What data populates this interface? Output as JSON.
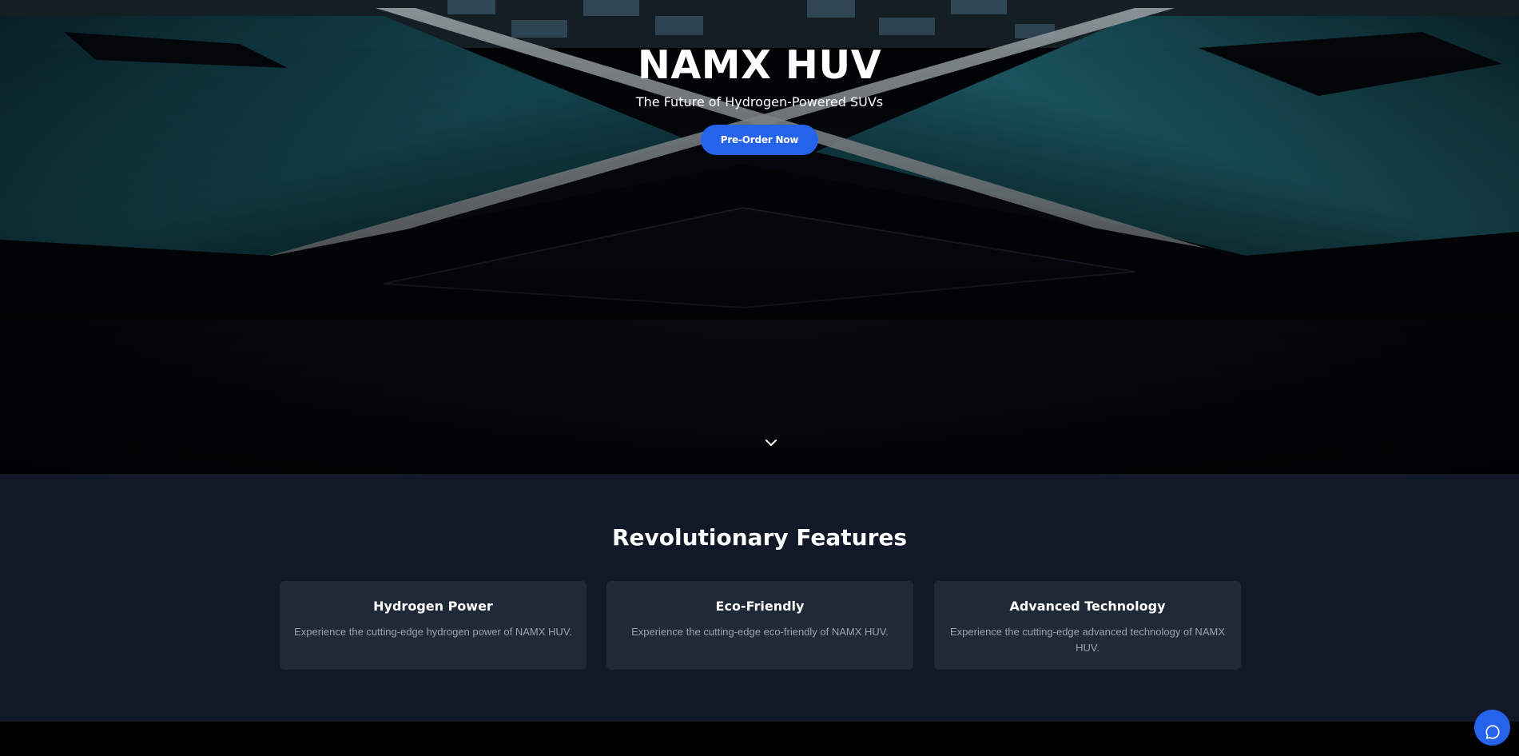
{
  "hero": {
    "title": "NAMX HUV",
    "subtitle": "The Future of Hydrogen-Powered SUVs",
    "cta_label": "Pre-Order Now",
    "scroll_icon": "chevron-down-icon"
  },
  "features": {
    "heading": "Revolutionary Features",
    "cards": [
      {
        "title": "Hydrogen Power",
        "description": "Experience the cutting-edge hydrogen power of NAMX HUV."
      },
      {
        "title": "Eco-Friendly",
        "description": "Experience the cutting-edge eco-friendly of NAMX HUV."
      },
      {
        "title": "Advanced Technology",
        "description": "Experience the cutting-edge advanced technology of NAMX HUV."
      }
    ]
  },
  "chat": {
    "icon": "chat-bubble-icon"
  },
  "colors": {
    "accent": "#2563eb",
    "features_bg": "#111827",
    "card_bg": "#1f2937",
    "muted_text": "#9ca3af"
  }
}
